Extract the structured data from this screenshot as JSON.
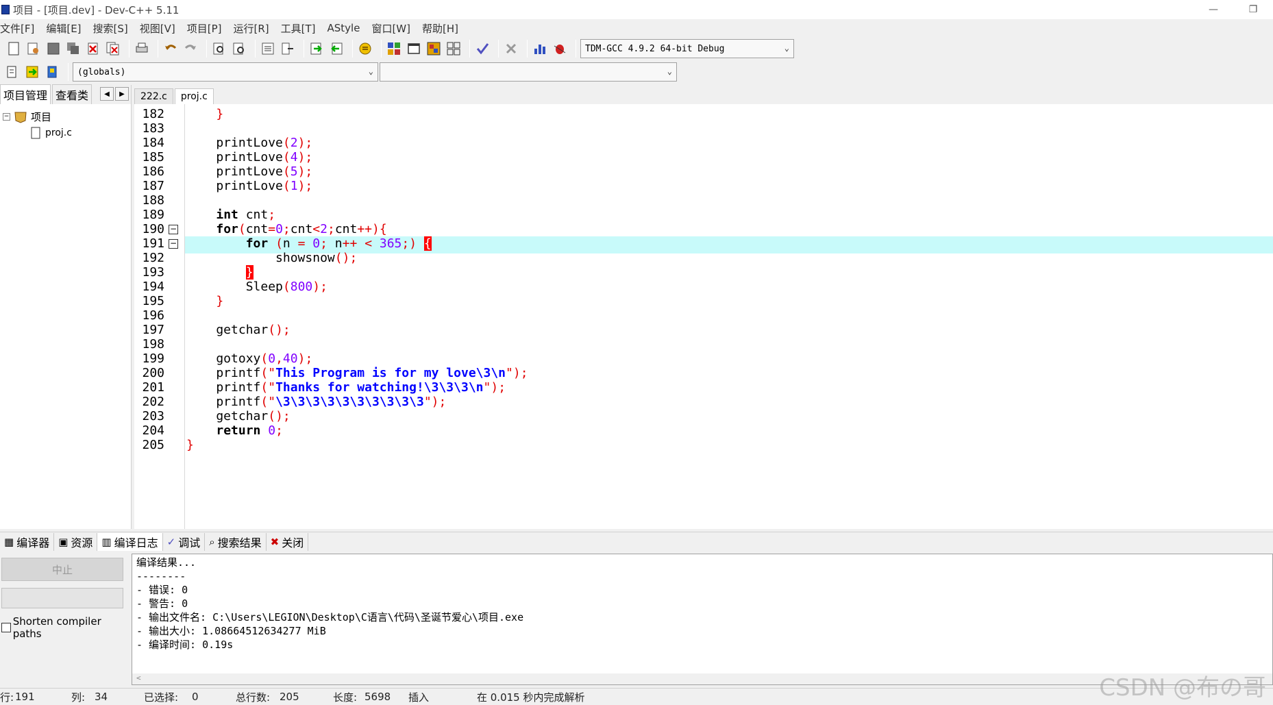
{
  "window": {
    "title": "项目 - [项目.dev] - Dev-C++ 5.11",
    "minimize": "—",
    "restore": "❐"
  },
  "menu": [
    "文件[F]",
    "编辑[E]",
    "搜索[S]",
    "视图[V]",
    "项目[P]",
    "运行[R]",
    "工具[T]",
    "AStyle",
    "窗口[W]",
    "帮助[H]"
  ],
  "toolbar": {
    "compiler": "TDM-GCC 4.9.2 64-bit Debug",
    "scope": "(globals)",
    "member": ""
  },
  "left_panel": {
    "tabs": [
      "项目管理",
      "查看类"
    ],
    "project": "项目",
    "file": "proj.c"
  },
  "editor": {
    "tabs": [
      "222.c",
      "proj.c"
    ],
    "lines": [
      {
        "n": "182",
        "code": "    }"
      },
      {
        "n": "183",
        "code": ""
      },
      {
        "n": "184",
        "code": "    printLove(2);"
      },
      {
        "n": "185",
        "code": "    printLove(4);"
      },
      {
        "n": "186",
        "code": "    printLove(5);"
      },
      {
        "n": "187",
        "code": "    printLove(1);"
      },
      {
        "n": "188",
        "code": ""
      },
      {
        "n": "189",
        "code": "    int cnt;"
      },
      {
        "n": "190",
        "code": "    for(cnt=0;cnt<2;cnt++){"
      },
      {
        "n": "191",
        "code": "        for (n = 0; n++ < 365;) {"
      },
      {
        "n": "192",
        "code": "            showsnow();"
      },
      {
        "n": "193",
        "code": "        }"
      },
      {
        "n": "194",
        "code": "        Sleep(800);"
      },
      {
        "n": "195",
        "code": "    }"
      },
      {
        "n": "196",
        "code": ""
      },
      {
        "n": "197",
        "code": "    getchar();"
      },
      {
        "n": "198",
        "code": ""
      },
      {
        "n": "199",
        "code": "    gotoxy(0,40);"
      },
      {
        "n": "200",
        "code": "    printf(\"This Program is for my love\\3\\n\");"
      },
      {
        "n": "201",
        "code": "    printf(\"Thanks for watching!\\3\\3\\3\\n\");"
      },
      {
        "n": "202",
        "code": "    printf(\"\\3\\3\\3\\3\\3\\3\\3\\3\\3\\3\");"
      },
      {
        "n": "203",
        "code": "    getchar();"
      },
      {
        "n": "204",
        "code": "    return 0;"
      },
      {
        "n": "205",
        "code": "}"
      }
    ],
    "current_line": "191"
  },
  "bottom_tabs": [
    "编译器",
    "资源",
    "编译日志",
    "调试",
    "搜索结果",
    "关闭"
  ],
  "output": {
    "abort_button": "中止",
    "shorten_label": "Shorten compiler paths",
    "lines": [
      "编译结果...",
      "--------",
      "- 错误: 0",
      "- 警告: 0",
      "- 输出文件名: C:\\Users\\LEGION\\Desktop\\C语言\\代码\\圣诞节爱心\\项目.exe",
      "- 输出大小: 1.08664512634277 MiB",
      "- 编译时间: 0.19s"
    ]
  },
  "status": {
    "row_label": "行:",
    "row": "191",
    "col_label": "列:",
    "col": "34",
    "sel_label": "已选择:",
    "sel": "0",
    "total_label": "总行数:",
    "total": "205",
    "len_label": "长度:",
    "len": "5698",
    "mode": "插入",
    "parse": "在 0.015 秒内完成解析"
  },
  "watermark": "CSDN @布の哥"
}
